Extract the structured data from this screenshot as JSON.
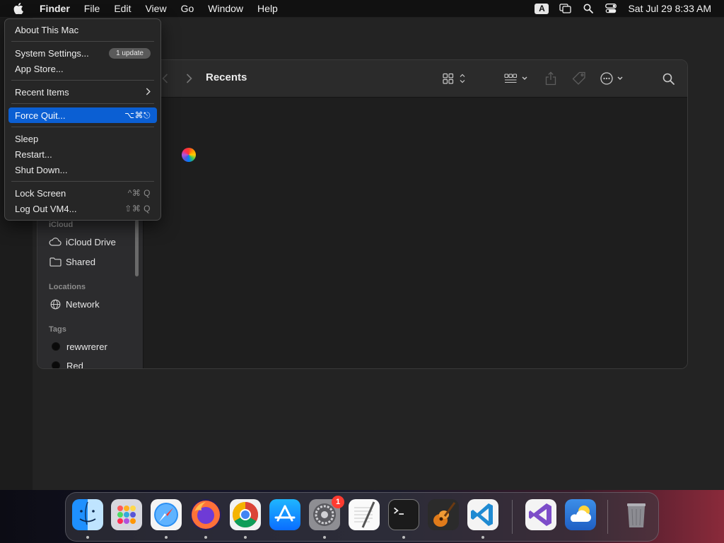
{
  "menubar": {
    "app_name": "Finder",
    "items": [
      "File",
      "Edit",
      "View",
      "Go",
      "Window",
      "Help"
    ],
    "input_source": "A",
    "clock": "Sat Jul 29  8:33 AM"
  },
  "apple_menu": {
    "about": "About This Mac",
    "system_settings": "System Settings...",
    "system_settings_badge": "1 update",
    "app_store": "App Store...",
    "recent_items": "Recent Items",
    "force_quit": "Force Quit...",
    "force_quit_shortcut": "⌥⌘⎋",
    "sleep": "Sleep",
    "restart": "Restart...",
    "shut_down": "Shut Down...",
    "lock_screen": "Lock Screen",
    "lock_screen_shortcut": "^⌘ Q",
    "log_out": "Log Out VM4...",
    "log_out_shortcut": "⇧⌘ Q"
  },
  "finder": {
    "title": "Recents",
    "sidebar": {
      "icloud_header": "iCloud",
      "icloud_drive": "iCloud Drive",
      "shared": "Shared",
      "locations_header": "Locations",
      "network": "Network",
      "tags_header": "Tags",
      "tags": [
        "rewwrerer",
        "Red"
      ]
    }
  },
  "dock": {
    "apps": [
      "finder-icon",
      "launchpad-icon",
      "safari-icon",
      "firefox-icon",
      "chrome-icon",
      "app-store-icon",
      "system-settings-icon",
      "textedit-icon",
      "terminal-icon",
      "garageband-icon",
      "vscode-icon",
      "visual-studio-icon",
      "weather-icon",
      "trash-icon"
    ],
    "system_settings_badge": "1"
  },
  "colors": {
    "menu_highlight": "#0b5fd3",
    "badge_red": "#ff3b30"
  }
}
